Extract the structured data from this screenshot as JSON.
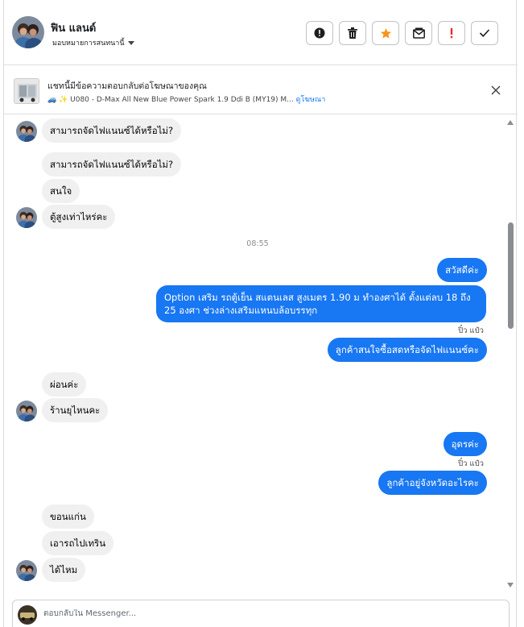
{
  "header": {
    "contact_name": "ฟิน แลนด์",
    "assign_label": "มอบหมายการสนทนานี้"
  },
  "toolbar": {
    "buttons": [
      {
        "name": "mark-spam",
        "icon": "alert-circle-icon"
      },
      {
        "name": "delete",
        "icon": "trash-icon"
      },
      {
        "name": "star",
        "icon": "star-icon"
      },
      {
        "name": "mark-unread",
        "icon": "envelope-icon"
      },
      {
        "name": "follow-up",
        "icon": "exclamation-icon"
      },
      {
        "name": "done",
        "icon": "check-icon"
      }
    ],
    "star_color": "#f7931e"
  },
  "ad_banner": {
    "title": "แชทนี้มีข้อความตอบกลับต่อโฆษณาของคุณ",
    "subtitle": "🚙 ✨ U080 - D-Max All New Blue Power Spark 1.9 Ddi B (MY19) M...",
    "link": "ดูโฆษณา"
  },
  "messages": [
    {
      "dir": "in",
      "text": "สามารถจัดไฟแนนซ์ได้หรือไม่?",
      "avatar": true
    },
    {
      "dir": "in",
      "text": "สามารถจัดไฟแนนซ์ได้หรือไม่?",
      "avatar": false
    },
    {
      "dir": "in",
      "text": "สนใจ",
      "avatar": false
    },
    {
      "dir": "in",
      "text": "ตู้สูงเท่าไหร่คะ",
      "avatar": true
    },
    {
      "time": "08:55"
    },
    {
      "dir": "out",
      "text": "สวัสดีค่ะ"
    },
    {
      "dir": "out",
      "text": "Option เสริม รถตู้เย็น สแตนเลส สูงเมตร 1.90 ม ทำองศาได้ ตั้งแต่ลบ 18 ถึง 25 องศา ช่วงล่างเสริมแหนบล้อบรรทุก"
    },
    {
      "seen": "ปิ๋ว แป๋ว"
    },
    {
      "dir": "out",
      "text": "ลูกค้าสนใจซื้อสดหรือจัดไฟแนนซ์คะ"
    },
    {
      "dir": "in",
      "text": "ผ่อนค่ะ",
      "avatar": false
    },
    {
      "dir": "in",
      "text": "ร้านยุไหนคะ",
      "avatar": true
    },
    {
      "dir": "out",
      "text": "อุดรค่ะ"
    },
    {
      "seen": "ปิ๋ว แป๋ว"
    },
    {
      "dir": "out",
      "text": "ลูกค้าอยู่จังหวัดอะไรคะ"
    },
    {
      "dir": "in",
      "text": "ขอนแก่น",
      "avatar": false
    },
    {
      "dir": "in",
      "text": "เอารถไปเทริน",
      "avatar": false
    },
    {
      "dir": "in",
      "text": "ได้ไหม",
      "avatar": true
    }
  ],
  "composer": {
    "placeholder": "ตอบกลับใน Messenger..."
  },
  "colors": {
    "outgoing_bubble": "#1877f2",
    "incoming_bubble": "#f0f0f0"
  }
}
